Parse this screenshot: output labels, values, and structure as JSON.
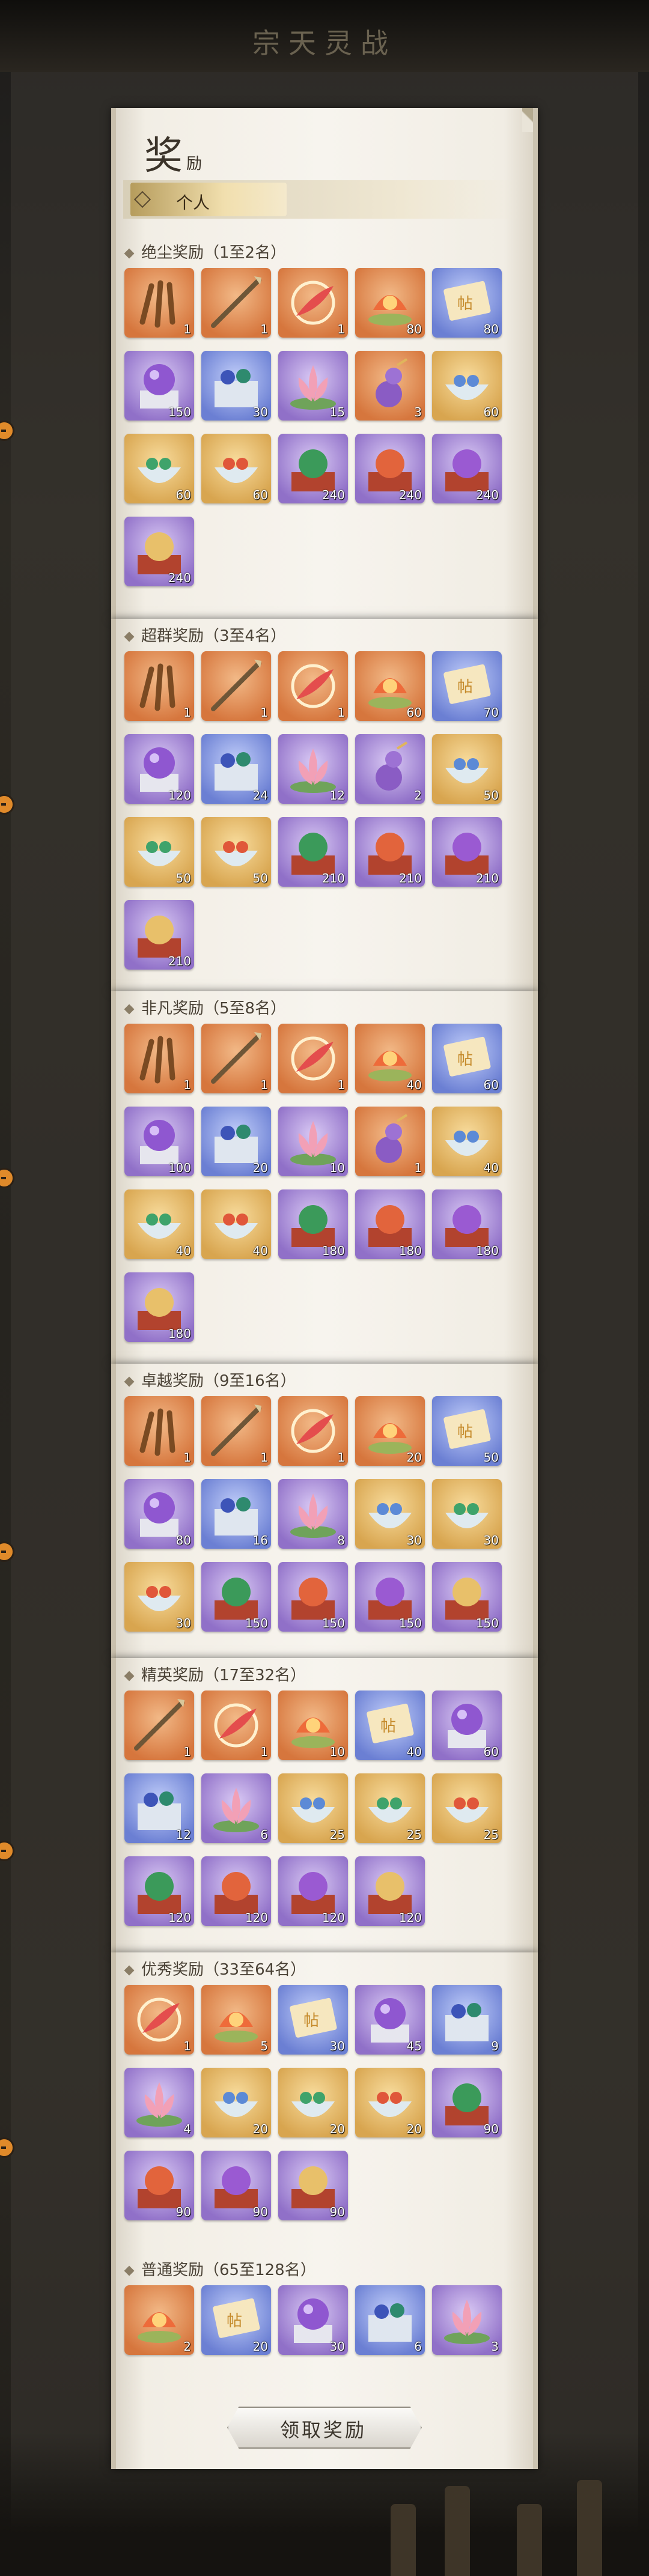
{
  "header": {
    "title": "宗天灵战"
  },
  "panel": {
    "title_main": "奖",
    "title_sub": "励",
    "tab_label": "个人"
  },
  "claim_button": {
    "label": "领取奖励"
  },
  "colors": {
    "orange": "#d6763d",
    "gold": "#d8a54f",
    "purple": "#9070c8",
    "blue": "#6b7fd3"
  },
  "tiers": [
    {
      "label": "绝尘奖励（1至2名）",
      "items": [
        {
          "icon": "claw-icon",
          "bg": "orange",
          "count": "1"
        },
        {
          "icon": "spear-icon",
          "bg": "orange",
          "count": "1"
        },
        {
          "icon": "feather-ring-icon",
          "bg": "orange",
          "count": "1"
        },
        {
          "icon": "lotus-lantern-icon",
          "bg": "orange",
          "count": "80"
        },
        {
          "icon": "scroll-icon",
          "bg": "blue",
          "count": "80"
        },
        {
          "icon": "orb-box-icon",
          "bg": "purple",
          "count": "150"
        },
        {
          "icon": "gem-chest-icon",
          "bg": "blue",
          "count": "30"
        },
        {
          "icon": "lotus-icon",
          "bg": "purple",
          "count": "15"
        },
        {
          "icon": "gourd-icon",
          "bg": "orange",
          "count": "3"
        },
        {
          "icon": "bowl-icon",
          "bg": "gold",
          "count": "60"
        },
        {
          "icon": "green-bowl-icon",
          "bg": "gold",
          "count": "60"
        },
        {
          "icon": "red-bowl-icon",
          "bg": "gold",
          "count": "60"
        },
        {
          "icon": "green-orb-box-icon",
          "bg": "purple",
          "count": "240"
        },
        {
          "icon": "red-orb-box-icon",
          "bg": "purple",
          "count": "240"
        },
        {
          "icon": "purple-orb-box-icon",
          "bg": "purple",
          "count": "240"
        },
        {
          "icon": "gold-orb-box-icon",
          "bg": "purple",
          "count": "240"
        }
      ]
    },
    {
      "label": "超群奖励（3至4名）",
      "items": [
        {
          "icon": "claw-icon",
          "bg": "orange",
          "count": "1"
        },
        {
          "icon": "spear-icon",
          "bg": "orange",
          "count": "1"
        },
        {
          "icon": "feather-ring-icon",
          "bg": "orange",
          "count": "1"
        },
        {
          "icon": "lotus-lantern-icon",
          "bg": "orange",
          "count": "60"
        },
        {
          "icon": "scroll-icon",
          "bg": "blue",
          "count": "70"
        },
        {
          "icon": "orb-box-icon",
          "bg": "purple",
          "count": "120"
        },
        {
          "icon": "gem-chest-icon",
          "bg": "blue",
          "count": "24"
        },
        {
          "icon": "lotus-icon",
          "bg": "purple",
          "count": "12"
        },
        {
          "icon": "gourd-icon",
          "bg": "purple",
          "count": "2"
        },
        {
          "icon": "bowl-icon",
          "bg": "gold",
          "count": "50"
        },
        {
          "icon": "green-bowl-icon",
          "bg": "gold",
          "count": "50"
        },
        {
          "icon": "red-bowl-icon",
          "bg": "gold",
          "count": "50"
        },
        {
          "icon": "green-orb-box-icon",
          "bg": "purple",
          "count": "210"
        },
        {
          "icon": "red-orb-box-icon",
          "bg": "purple",
          "count": "210"
        },
        {
          "icon": "purple-orb-box-icon",
          "bg": "purple",
          "count": "210"
        },
        {
          "icon": "gold-orb-box-icon",
          "bg": "purple",
          "count": "210"
        }
      ]
    },
    {
      "label": "非凡奖励（5至8名）",
      "items": [
        {
          "icon": "claw-icon",
          "bg": "orange",
          "count": "1"
        },
        {
          "icon": "spear-icon",
          "bg": "orange",
          "count": "1"
        },
        {
          "icon": "feather-ring-icon",
          "bg": "orange",
          "count": "1"
        },
        {
          "icon": "lotus-lantern-icon",
          "bg": "orange",
          "count": "40"
        },
        {
          "icon": "scroll-icon",
          "bg": "blue",
          "count": "60"
        },
        {
          "icon": "orb-box-icon",
          "bg": "purple",
          "count": "100"
        },
        {
          "icon": "gem-chest-icon",
          "bg": "blue",
          "count": "20"
        },
        {
          "icon": "lotus-icon",
          "bg": "purple",
          "count": "10"
        },
        {
          "icon": "gourd-icon",
          "bg": "orange",
          "count": "1"
        },
        {
          "icon": "bowl-icon",
          "bg": "gold",
          "count": "40"
        },
        {
          "icon": "green-bowl-icon",
          "bg": "gold",
          "count": "40"
        },
        {
          "icon": "red-bowl-icon",
          "bg": "gold",
          "count": "40"
        },
        {
          "icon": "green-orb-box-icon",
          "bg": "purple",
          "count": "180"
        },
        {
          "icon": "red-orb-box-icon",
          "bg": "purple",
          "count": "180"
        },
        {
          "icon": "purple-orb-box-icon",
          "bg": "purple",
          "count": "180"
        },
        {
          "icon": "gold-orb-box-icon",
          "bg": "purple",
          "count": "180"
        }
      ]
    },
    {
      "label": "卓越奖励（9至16名）",
      "items": [
        {
          "icon": "claw-icon",
          "bg": "orange",
          "count": "1"
        },
        {
          "icon": "spear-icon",
          "bg": "orange",
          "count": "1"
        },
        {
          "icon": "feather-ring-icon",
          "bg": "orange",
          "count": "1"
        },
        {
          "icon": "lotus-lantern-icon",
          "bg": "orange",
          "count": "20"
        },
        {
          "icon": "scroll-icon",
          "bg": "blue",
          "count": "50"
        },
        {
          "icon": "orb-box-icon",
          "bg": "purple",
          "count": "80"
        },
        {
          "icon": "gem-chest-icon",
          "bg": "blue",
          "count": "16"
        },
        {
          "icon": "lotus-icon",
          "bg": "purple",
          "count": "8"
        },
        {
          "icon": "bowl-icon",
          "bg": "gold",
          "count": "30"
        },
        {
          "icon": "green-bowl-icon",
          "bg": "gold",
          "count": "30"
        },
        {
          "icon": "red-bowl-icon",
          "bg": "gold",
          "count": "30"
        },
        {
          "icon": "green-orb-box-icon",
          "bg": "purple",
          "count": "150"
        },
        {
          "icon": "red-orb-box-icon",
          "bg": "purple",
          "count": "150"
        },
        {
          "icon": "purple-orb-box-icon",
          "bg": "purple",
          "count": "150"
        },
        {
          "icon": "gold-orb-box-icon",
          "bg": "purple",
          "count": "150"
        }
      ]
    },
    {
      "label": "精英奖励（17至32名）",
      "items": [
        {
          "icon": "spear-icon",
          "bg": "orange",
          "count": "1"
        },
        {
          "icon": "feather-ring-icon",
          "bg": "orange",
          "count": "1"
        },
        {
          "icon": "lotus-lantern-icon",
          "bg": "orange",
          "count": "10"
        },
        {
          "icon": "scroll-icon",
          "bg": "blue",
          "count": "40"
        },
        {
          "icon": "orb-box-icon",
          "bg": "purple",
          "count": "60"
        },
        {
          "icon": "gem-chest-icon",
          "bg": "blue",
          "count": "12"
        },
        {
          "icon": "lotus-icon",
          "bg": "purple",
          "count": "6"
        },
        {
          "icon": "bowl-icon",
          "bg": "gold",
          "count": "25"
        },
        {
          "icon": "green-bowl-icon",
          "bg": "gold",
          "count": "25"
        },
        {
          "icon": "red-bowl-icon",
          "bg": "gold",
          "count": "25"
        },
        {
          "icon": "green-orb-box-icon",
          "bg": "purple",
          "count": "120"
        },
        {
          "icon": "red-orb-box-icon",
          "bg": "purple",
          "count": "120"
        },
        {
          "icon": "purple-orb-box-icon",
          "bg": "purple",
          "count": "120"
        },
        {
          "icon": "gold-orb-box-icon",
          "bg": "purple",
          "count": "120"
        }
      ]
    },
    {
      "label": "优秀奖励（33至64名）",
      "items": [
        {
          "icon": "feather-ring-icon",
          "bg": "orange",
          "count": "1"
        },
        {
          "icon": "lotus-lantern-icon",
          "bg": "orange",
          "count": "5"
        },
        {
          "icon": "scroll-icon",
          "bg": "blue",
          "count": "30"
        },
        {
          "icon": "orb-box-icon",
          "bg": "purple",
          "count": "45"
        },
        {
          "icon": "gem-chest-icon",
          "bg": "blue",
          "count": "9"
        },
        {
          "icon": "lotus-icon",
          "bg": "purple",
          "count": "4"
        },
        {
          "icon": "bowl-icon",
          "bg": "gold",
          "count": "20"
        },
        {
          "icon": "green-bowl-icon",
          "bg": "gold",
          "count": "20"
        },
        {
          "icon": "red-bowl-icon",
          "bg": "gold",
          "count": "20"
        },
        {
          "icon": "green-orb-box-icon",
          "bg": "purple",
          "count": "90"
        },
        {
          "icon": "red-orb-box-icon",
          "bg": "purple",
          "count": "90"
        },
        {
          "icon": "purple-orb-box-icon",
          "bg": "purple",
          "count": "90"
        },
        {
          "icon": "gold-orb-box-icon",
          "bg": "purple",
          "count": "90"
        }
      ]
    },
    {
      "label": "普通奖励（65至128名）",
      "items": [
        {
          "icon": "lotus-lantern-icon",
          "bg": "orange",
          "count": "2"
        },
        {
          "icon": "scroll-icon",
          "bg": "blue",
          "count": "20"
        },
        {
          "icon": "orb-box-icon",
          "bg": "purple",
          "count": "30"
        },
        {
          "icon": "gem-chest-icon",
          "bg": "blue",
          "count": "6"
        },
        {
          "icon": "lotus-icon",
          "bg": "purple",
          "count": "3"
        }
      ]
    }
  ]
}
